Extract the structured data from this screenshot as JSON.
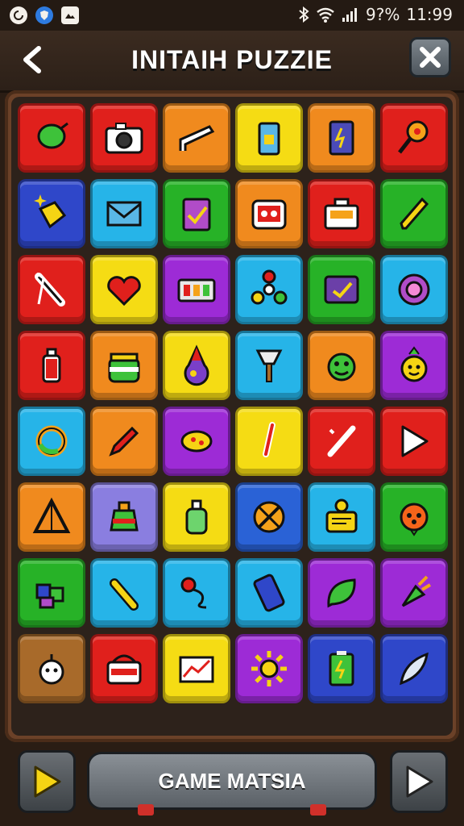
{
  "status_bar": {
    "signal_text": "9?%",
    "time": "11:99",
    "left_icons": [
      "sync-icon",
      "shield-icon",
      "photo-icon"
    ],
    "right_icons": [
      "bluetooth-icon",
      "wifi-icon",
      "signal-icon"
    ]
  },
  "header": {
    "title": "INITAIH PUZZIE",
    "back_icon": "back-arrow-icon",
    "close_icon": "close-icon"
  },
  "board": {
    "rows": 8,
    "cols": 6,
    "tiles": [
      {
        "color": "#e0201c",
        "icon": "balloon"
      },
      {
        "color": "#e0201c",
        "icon": "camera"
      },
      {
        "color": "#f08a1e",
        "icon": "ramp"
      },
      {
        "color": "#f5dc14",
        "icon": "battery"
      },
      {
        "color": "#f08a1e",
        "icon": "phone"
      },
      {
        "color": "#e0201c",
        "icon": "key"
      },
      {
        "color": "#2f47c9",
        "icon": "sparkle-cube"
      },
      {
        "color": "#26b4e8",
        "icon": "envelope"
      },
      {
        "color": "#27b227",
        "icon": "clipboard"
      },
      {
        "color": "#f08a1e",
        "icon": "radio"
      },
      {
        "color": "#e0201c",
        "icon": "cash-register"
      },
      {
        "color": "#27b227",
        "icon": "pencil"
      },
      {
        "color": "#e0201c",
        "icon": "tool"
      },
      {
        "color": "#f5dc14",
        "icon": "heart-bubble"
      },
      {
        "color": "#9d2bd6",
        "icon": "control-panel"
      },
      {
        "color": "#26b4e8",
        "icon": "spinner"
      },
      {
        "color": "#27b227",
        "icon": "tablet-check"
      },
      {
        "color": "#26b4e8",
        "icon": "ring"
      },
      {
        "color": "#e0201c",
        "icon": "bottle"
      },
      {
        "color": "#f08a1e",
        "icon": "jar"
      },
      {
        "color": "#f5dc14",
        "icon": "potion"
      },
      {
        "color": "#26b4e8",
        "icon": "plunger"
      },
      {
        "color": "#f08a1e",
        "icon": "monster"
      },
      {
        "color": "#9d2bd6",
        "icon": "fruit-face"
      },
      {
        "color": "#26b4e8",
        "icon": "swirl"
      },
      {
        "color": "#f08a1e",
        "icon": "marker"
      },
      {
        "color": "#9d2bd6",
        "icon": "pizza"
      },
      {
        "color": "#f5dc14",
        "icon": "thermometer"
      },
      {
        "color": "#e0201c",
        "icon": "slash"
      },
      {
        "color": "#e0201c",
        "icon": "play"
      },
      {
        "color": "#f08a1e",
        "icon": "pyramid"
      },
      {
        "color": "#8a7ee0",
        "icon": "urn"
      },
      {
        "color": "#f5dc14",
        "icon": "bottle-green"
      },
      {
        "color": "#2a62d6",
        "icon": "no-sign"
      },
      {
        "color": "#26b4e8",
        "icon": "robot-note"
      },
      {
        "color": "#27b227",
        "icon": "orange-face"
      },
      {
        "color": "#27b227",
        "icon": "cubes"
      },
      {
        "color": "#26b4e8",
        "icon": "tube"
      },
      {
        "color": "#26b4e8",
        "icon": "pin-wire"
      },
      {
        "color": "#26b4e8",
        "icon": "phone-blue"
      },
      {
        "color": "#9d2bd6",
        "icon": "leaf-bubble"
      },
      {
        "color": "#9d2bd6",
        "icon": "carrot"
      },
      {
        "color": "#a86a2a",
        "icon": "doll-face"
      },
      {
        "color": "#e0201c",
        "icon": "basket"
      },
      {
        "color": "#f5dc14",
        "icon": "chart-card"
      },
      {
        "color": "#9d2bd6",
        "icon": "sun"
      },
      {
        "color": "#2f47c9",
        "icon": "battery-green"
      },
      {
        "color": "#2f47c9",
        "icon": "feather"
      }
    ]
  },
  "footer": {
    "main_button_label": "GAME MATSIA",
    "left_button_icon": "play-yellow-icon",
    "right_button_icon": "play-white-icon"
  }
}
